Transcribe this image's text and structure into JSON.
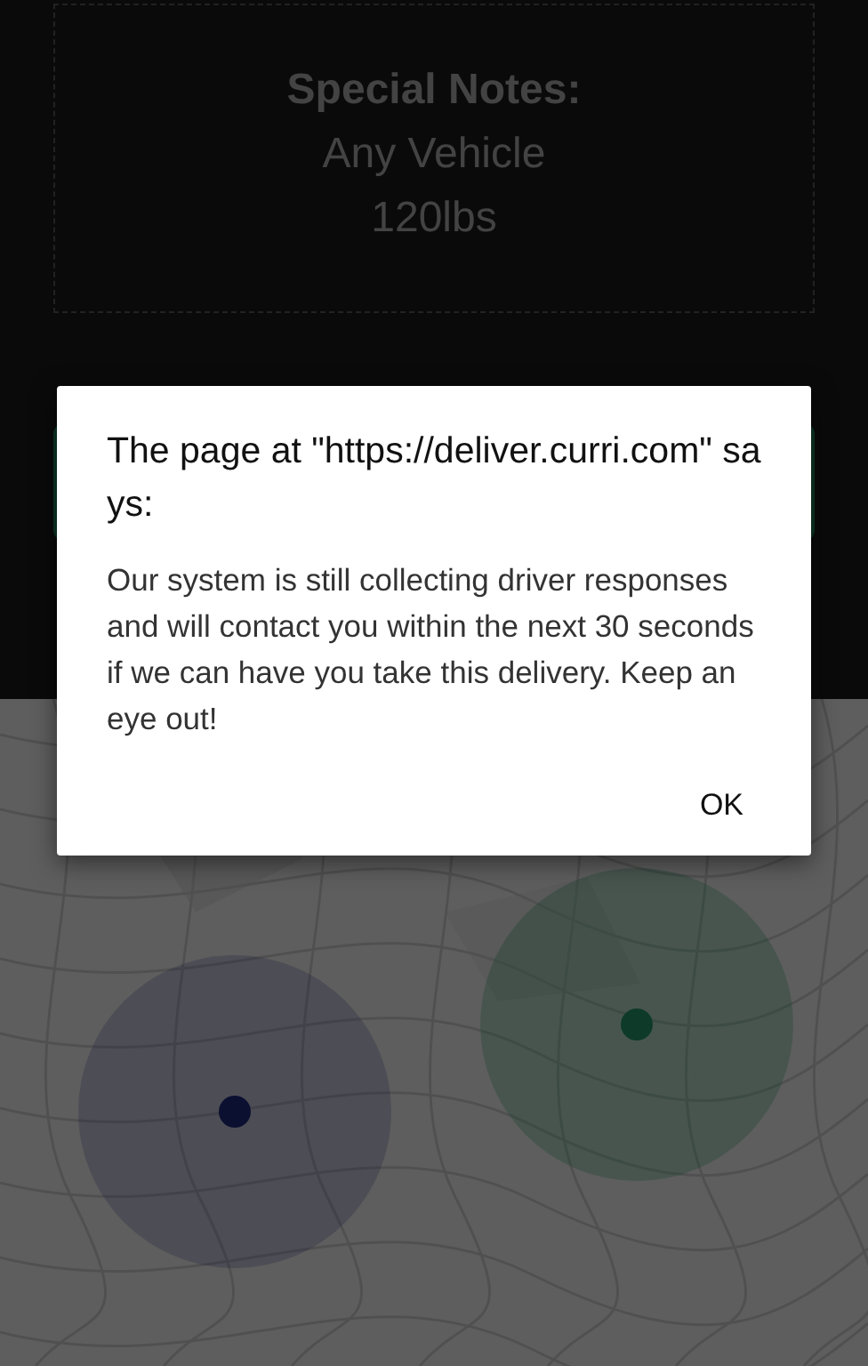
{
  "notes": {
    "heading": "Special Notes:",
    "lines": [
      "Any Vehicle",
      "120lbs"
    ]
  },
  "dialog": {
    "title": "The page at \"https://deliver.curri.com\" says:",
    "message": "Our system is still collecting driver responses and will contact you within the next 30 seconds if we can have you take this delivery. Keep an eye out!",
    "buttons": [
      "OK"
    ]
  }
}
